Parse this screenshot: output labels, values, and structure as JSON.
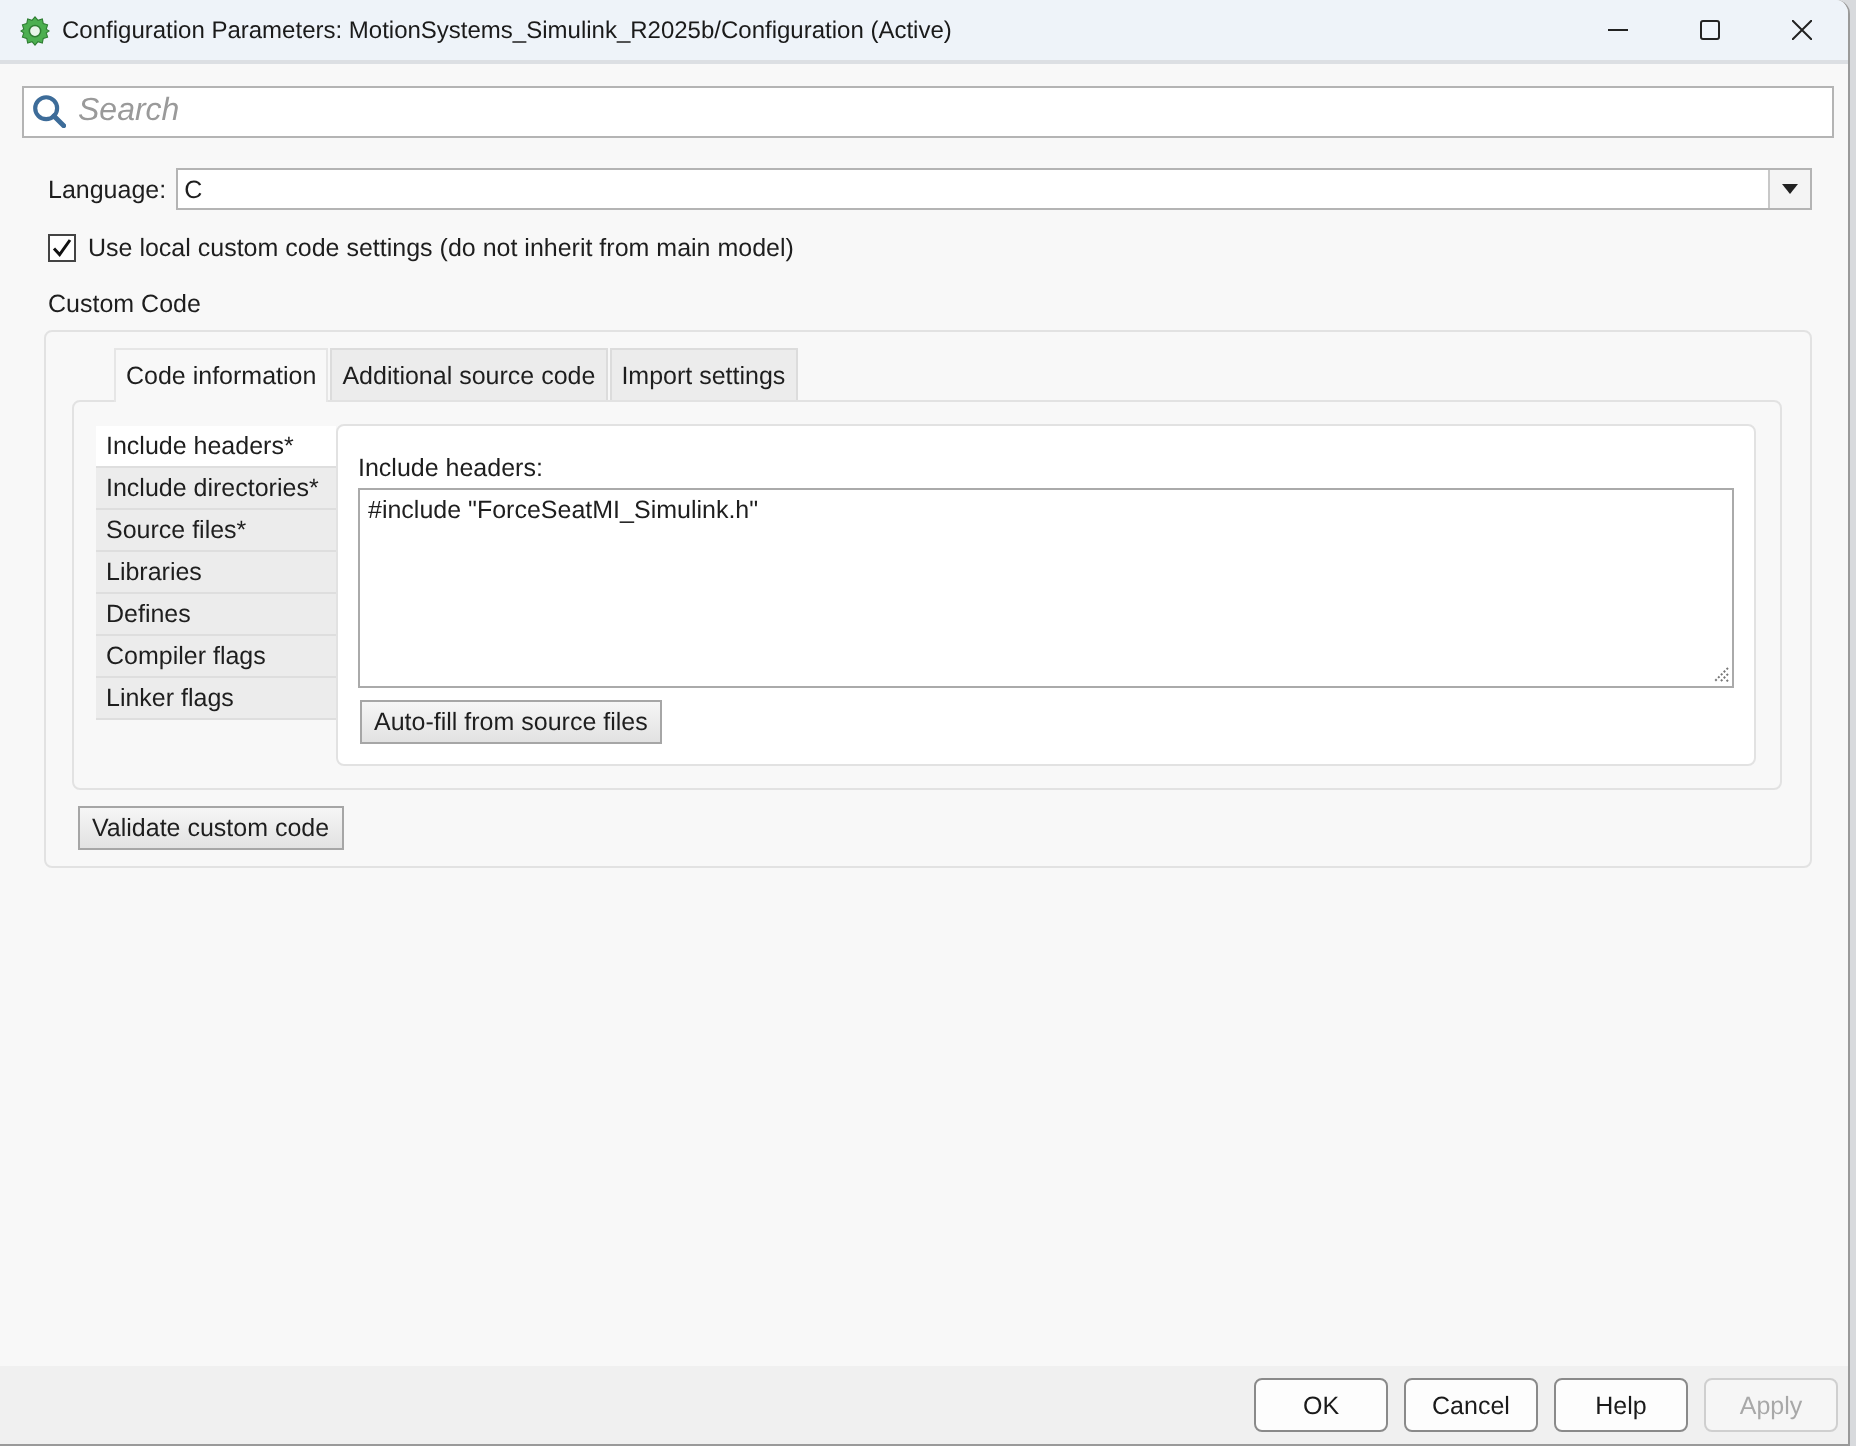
{
  "window": {
    "title": "Configuration Parameters: MotionSystems_Simulink_R2025b/Configuration (Active)"
  },
  "search": {
    "placeholder": "Search"
  },
  "language": {
    "label": "Language:",
    "value": "C"
  },
  "local_settings": {
    "label": "Use local custom code settings (do not inherit from main model)",
    "checked": true
  },
  "custom_code": {
    "title": "Custom Code",
    "tabs": [
      {
        "label": "Code information",
        "selected": true
      },
      {
        "label": "Additional source code",
        "selected": false
      },
      {
        "label": "Import settings",
        "selected": false
      }
    ],
    "categories": [
      {
        "label": "Include headers*",
        "selected": true
      },
      {
        "label": "Include directories*",
        "selected": false
      },
      {
        "label": "Source files*",
        "selected": false
      },
      {
        "label": "Libraries",
        "selected": false
      },
      {
        "label": "Defines",
        "selected": false
      },
      {
        "label": "Compiler flags",
        "selected": false
      },
      {
        "label": "Linker flags",
        "selected": false
      }
    ],
    "editor": {
      "label": "Include headers:",
      "value": "#include \"ForceSeatMI_Simulink.h\""
    },
    "autofill_button": "Auto-fill from source files",
    "validate_button": "Validate custom code"
  },
  "buttons": [
    {
      "label": "OK",
      "disabled": false
    },
    {
      "label": "Cancel",
      "disabled": false
    },
    {
      "label": "Help",
      "disabled": false
    },
    {
      "label": "Apply",
      "disabled": true
    }
  ]
}
